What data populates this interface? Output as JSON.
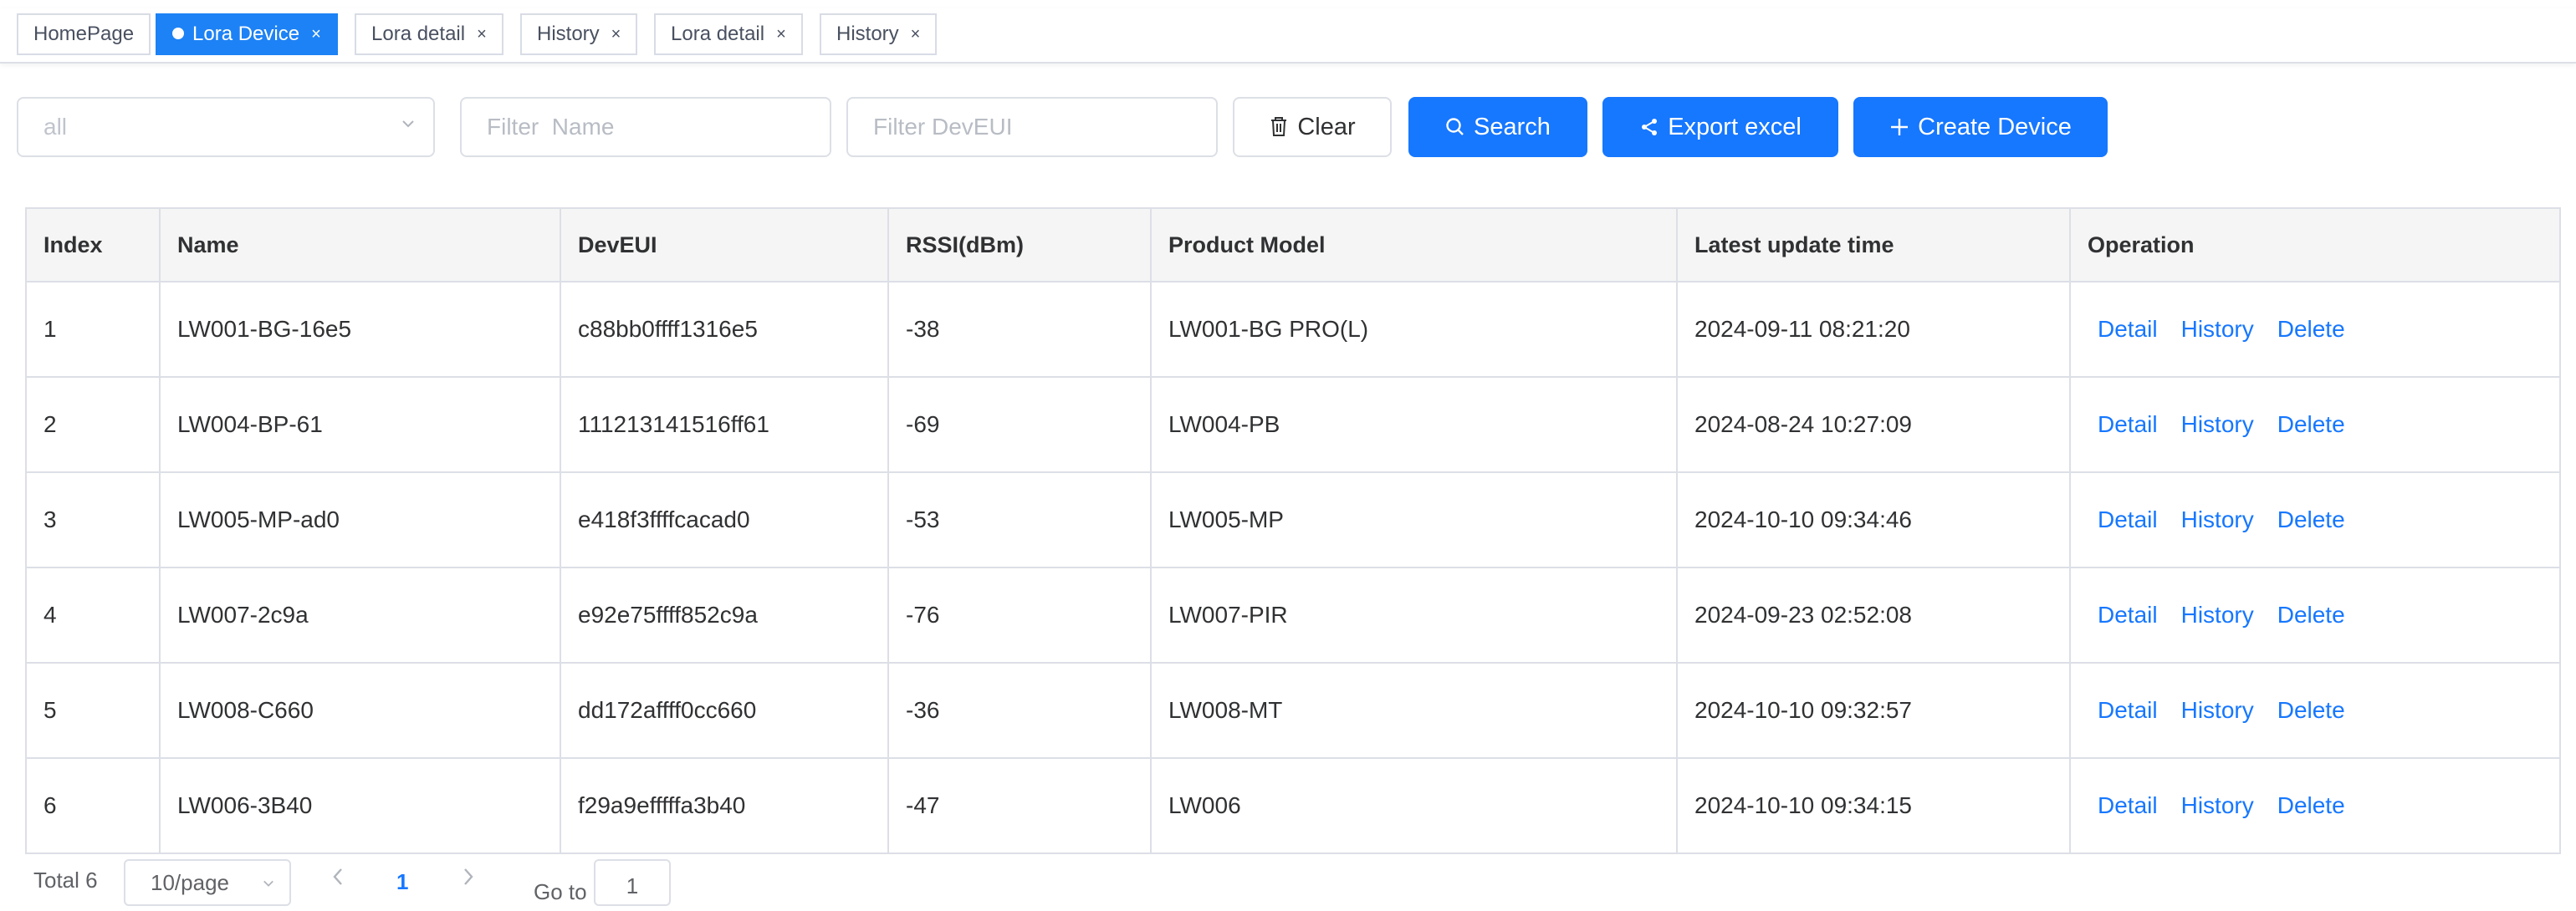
{
  "tabs": [
    {
      "label": "HomePage",
      "active": false,
      "closable": false
    },
    {
      "label": "Lora Device",
      "active": true,
      "closable": true
    },
    {
      "label": "Lora detail",
      "active": false,
      "closable": true
    },
    {
      "label": "History",
      "active": false,
      "closable": true
    },
    {
      "label": "Lora detail",
      "active": false,
      "closable": true
    },
    {
      "label": "History",
      "active": false,
      "closable": true
    }
  ],
  "filters": {
    "type_select_value": "all",
    "name_placeholder": "Filter  Name",
    "deveui_placeholder": "Filter DevEUI"
  },
  "toolbar": {
    "clear_label": "Clear",
    "search_label": "Search",
    "export_label": "Export excel",
    "create_label": "Create Device"
  },
  "table": {
    "columns": [
      "Index",
      "Name",
      "DevEUI",
      "RSSI(dBm)",
      "Product Model",
      "Latest update time",
      "Operation"
    ],
    "rows": [
      {
        "index": "1",
        "name": "LW001-BG-16e5",
        "deveui": "c88bb0ffff1316e5",
        "rssi": "-38",
        "model": "LW001-BG PRO(L)",
        "updated": "2024-09-11 08:21:20"
      },
      {
        "index": "2",
        "name": "LW004-BP-61",
        "deveui": "111213141516ff61",
        "rssi": "-69",
        "model": "LW004-PB",
        "updated": "2024-08-24 10:27:09"
      },
      {
        "index": "3",
        "name": "LW005-MP-ad0",
        "deveui": "e418f3ffffcacad0",
        "rssi": "-53",
        "model": "LW005-MP",
        "updated": "2024-10-10 09:34:46"
      },
      {
        "index": "4",
        "name": "LW007-2c9a",
        "deveui": "e92e75ffff852c9a",
        "rssi": "-76",
        "model": "LW007-PIR",
        "updated": "2024-09-23 02:52:08"
      },
      {
        "index": "5",
        "name": "LW008-C660",
        "deveui": "dd172affff0cc660",
        "rssi": "-36",
        "model": "LW008-MT",
        "updated": "2024-10-10 09:32:57"
      },
      {
        "index": "6",
        "name": "LW006-3B40",
        "deveui": "f29a9efffffa3b40",
        "rssi": "-47",
        "model": "LW006",
        "updated": "2024-10-10 09:34:15"
      }
    ],
    "actions": {
      "detail": "Detail",
      "history": "History",
      "delete": "Delete"
    }
  },
  "pagination": {
    "total_label": "Total 6",
    "page_size": "10/page",
    "current_page": "1",
    "goto_label": "Go to",
    "goto_value": "1"
  },
  "colors": {
    "primary": "#1677ff",
    "active_tab": "#1d82f5",
    "border": "#dcdfe6",
    "header_bg": "#f5f5f5"
  }
}
